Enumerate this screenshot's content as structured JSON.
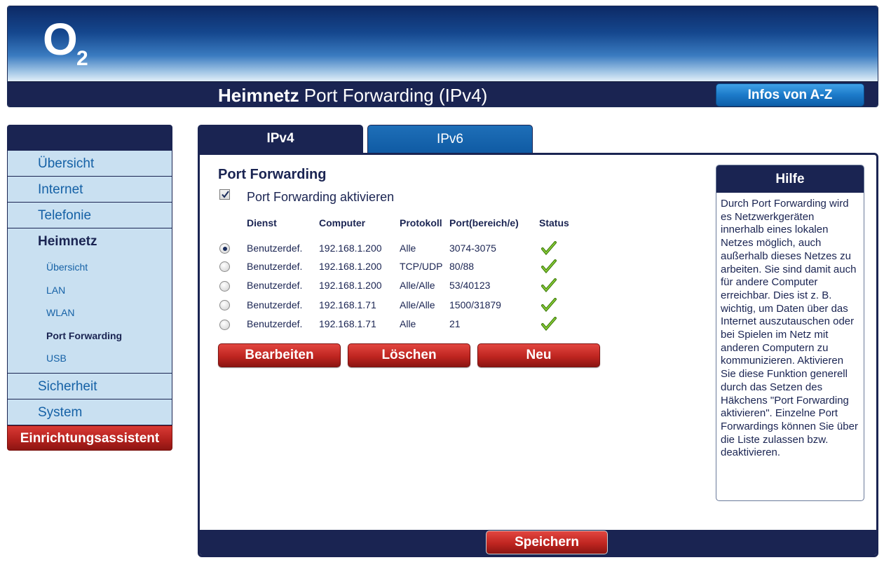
{
  "header": {
    "logo_text": "O",
    "logo_sub": "2",
    "title_strong": "Heimnetz",
    "title_rest": " Port Forwarding (IPv4)",
    "infos_button": "Infos von A-Z"
  },
  "sidebar": {
    "items": [
      {
        "label": "Übersicht"
      },
      {
        "label": "Internet"
      },
      {
        "label": "Telefonie"
      },
      {
        "label": "Heimnetz"
      }
    ],
    "subitems": [
      {
        "label": "Übersicht"
      },
      {
        "label": "LAN"
      },
      {
        "label": "WLAN"
      },
      {
        "label": "Port Forwarding"
      },
      {
        "label": "USB"
      }
    ],
    "items_after": [
      {
        "label": "Sicherheit"
      },
      {
        "label": "System"
      }
    ],
    "assistant": "Einrichtungsassistent"
  },
  "tabs": {
    "ipv4": "IPv4",
    "ipv6": "IPv6"
  },
  "main": {
    "section_title": "Port Forwarding",
    "enable_label": "Port Forwarding aktivieren",
    "enable_checked": true,
    "columns": [
      "Dienst",
      "Computer",
      "Protokoll",
      "Port(bereich/e)",
      "Status"
    ],
    "rows": [
      {
        "dienst": "Benutzerdef.",
        "computer": "192.168.1.200",
        "protokoll": "Alle",
        "port": "3074-3075",
        "selected": true
      },
      {
        "dienst": "Benutzerdef.",
        "computer": "192.168.1.200",
        "protokoll": "TCP/UDP",
        "port": "80/88",
        "selected": false
      },
      {
        "dienst": "Benutzerdef.",
        "computer": "192.168.1.200",
        "protokoll": "Alle/Alle",
        "port": "53/40123",
        "selected": false
      },
      {
        "dienst": "Benutzerdef.",
        "computer": "192.168.1.71",
        "protokoll": "Alle/Alle",
        "port": "1500/31879",
        "selected": false
      },
      {
        "dienst": "Benutzerdef.",
        "computer": "192.168.1.71",
        "protokoll": "Alle",
        "port": "21",
        "selected": false
      }
    ],
    "buttons": {
      "edit": "Bearbeiten",
      "delete": "Löschen",
      "new": "Neu"
    },
    "save": "Speichern"
  },
  "help": {
    "title": "Hilfe",
    "text": "Durch Port Forwarding wird es Netzwerkgeräten innerhalb eines lokalen Netzes möglich, auch außerhalb dieses Netzes zu arbeiten. Sie sind damit auch für andere Computer erreichbar. Dies ist z. B. wichtig, um Daten über das Internet auszutauschen oder bei Spielen im Netz mit anderen Computern zu kommunizieren. Aktivieren Sie diese Funktion generell durch das Setzen des Häkchens \"Port Forwarding aktivieren\". Einzelne Port Forwardings können Sie über die Liste zulassen bzw. deaktivieren."
  },
  "colors": {
    "navy": "#1a2452",
    "nav_bg": "#c9e0f1",
    "link_blue": "#1561a6",
    "red": "#bf2520",
    "status_green": "#5a9e1a"
  },
  "icons": {
    "status": "check-icon",
    "logo": "o2-logo"
  }
}
